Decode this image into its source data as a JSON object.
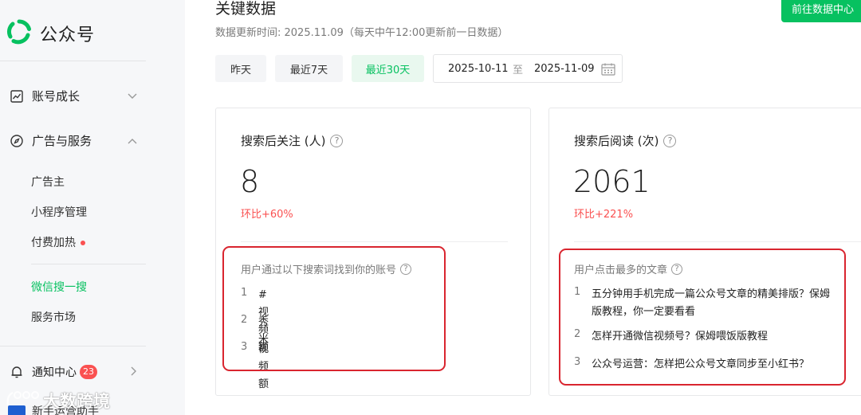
{
  "sidebar": {
    "app_name": "公众号",
    "groups": {
      "account_growth": "账号成长",
      "ads_services": "广告与服务"
    },
    "items": {
      "advertiser": "广告主",
      "mini_program": "小程序管理",
      "paid_boost": "付费加热",
      "wechat_search": "微信搜一搜",
      "service_market": "服务市场"
    },
    "notification": {
      "label": "通知中心",
      "count": "23"
    },
    "assistant_label": "新手运营助手",
    "watermark": "大数跨境"
  },
  "header": {
    "title": "关键数据",
    "update_info": "数据更新时间: 2025.11.09（每天中午12:00更新前一日数据）",
    "goto_button": "前往数据中心"
  },
  "filters": {
    "yesterday": "昨天",
    "last7": "最近7天",
    "last30": "最近30天",
    "active": "last30",
    "date_start": "2025-10-11",
    "date_sep": "至",
    "date_end": "2025-11-09"
  },
  "cards": {
    "follow": {
      "title": "搜索后关注 (人)",
      "value": "8",
      "ratio": "环比+60%",
      "list_title": "用户通过以下搜索词找到你的账号",
      "items": [
        {
          "index": "1",
          "text": "#视频额"
        },
        {
          "index": "2",
          "text": "秀米"
        },
        {
          "index": "3",
          "text": "视频额"
        }
      ]
    },
    "read": {
      "title": "搜索后阅读 (次)",
      "value": "2061",
      "ratio": "环比+221%",
      "list_title": "用户点击最多的文章",
      "items": [
        {
          "index": "1",
          "text": "五分钟用手机完成一篇公众号文章的精美排版？保姆版教程，你一定要看看"
        },
        {
          "index": "2",
          "text": "怎样开通微信视频号？保姆喂饭版教程"
        },
        {
          "index": "3",
          "text": "公众号运营：怎样把公众号文章同步至小红书？"
        }
      ]
    }
  },
  "colors": {
    "brand_green": "#07c160",
    "ratio_red": "#fa5151",
    "highlight_red": "#d9252f"
  },
  "icons": {
    "logo": "wechat-official-account-logo",
    "account_growth": "trend-chart-icon",
    "ads_services": "compass-icon",
    "notification": "bell-icon",
    "help": "question-circle-icon",
    "calendar": "calendar-icon"
  }
}
